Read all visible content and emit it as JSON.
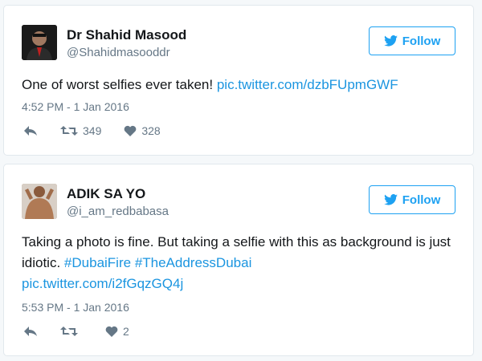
{
  "follow_label": "Follow",
  "colors": {
    "accent": "#1da1f2",
    "link": "#1b95e0",
    "muted": "#657786"
  },
  "tweets": [
    {
      "name": "Dr Shahid Masood",
      "handle": "@Shahidmasooddr",
      "text": "One of worst selfies ever taken! ",
      "link": "pic.twitter.com/dzbFUpmGWF",
      "time": "4:52 PM - 1 Jan 2016",
      "retweets": "349",
      "likes": "328"
    },
    {
      "name": "ADIK SA YO",
      "handle": "@i_am_redbabasa",
      "text": "Taking a photo is fine. But taking a selfie with this as background is just idiotic. ",
      "hashtag1": "#DubaiFire",
      "hashtag2": "#TheAddressDubai",
      "link": "pic.twitter.com/i2fGqzGQ4j",
      "time": "5:53 PM - 1 Jan 2016",
      "retweets": "",
      "likes": "2"
    }
  ]
}
